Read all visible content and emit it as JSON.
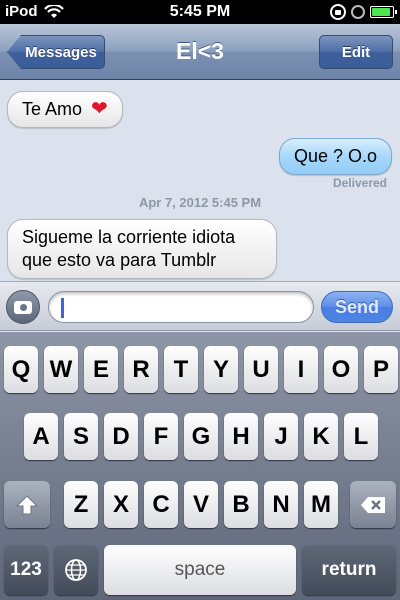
{
  "status_bar": {
    "carrier": "iPod",
    "time": "5:45 PM",
    "icons": [
      "wifi-icon",
      "rotation-lock-icon",
      "alarm-icon",
      "battery-icon"
    ],
    "battery_level": 0.9
  },
  "nav": {
    "back_label": "Messages",
    "title": "El<3",
    "edit_label": "Edit"
  },
  "messages": [
    {
      "direction": "incoming",
      "text": "Te Amo",
      "emoji": "❤"
    },
    {
      "direction": "outgoing",
      "text": "Que ? O.o"
    },
    {
      "direction": "incoming",
      "text": "Sigueme la corriente idiota que esto va para Tumblr"
    }
  ],
  "delivered": "Delivered",
  "timestamp": "Apr 7, 2012 5:45 PM",
  "composer": {
    "placeholder": "",
    "value": "",
    "send_label": "Send"
  },
  "keyboard": {
    "row1": [
      "Q",
      "W",
      "E",
      "R",
      "T",
      "Y",
      "U",
      "I",
      "O",
      "P"
    ],
    "row2": [
      "A",
      "S",
      "D",
      "F",
      "G",
      "H",
      "J",
      "K",
      "L"
    ],
    "row3": [
      "Z",
      "X",
      "C",
      "V",
      "B",
      "N",
      "M"
    ],
    "numbers_label": "123",
    "space_label": "space",
    "return_label": "return"
  },
  "colors": {
    "outgoing_bubble": "#a7d7fa",
    "incoming_bubble": "#ffffff",
    "send_button": "#5d8de9",
    "nav_bar": "#8b9fbd"
  }
}
